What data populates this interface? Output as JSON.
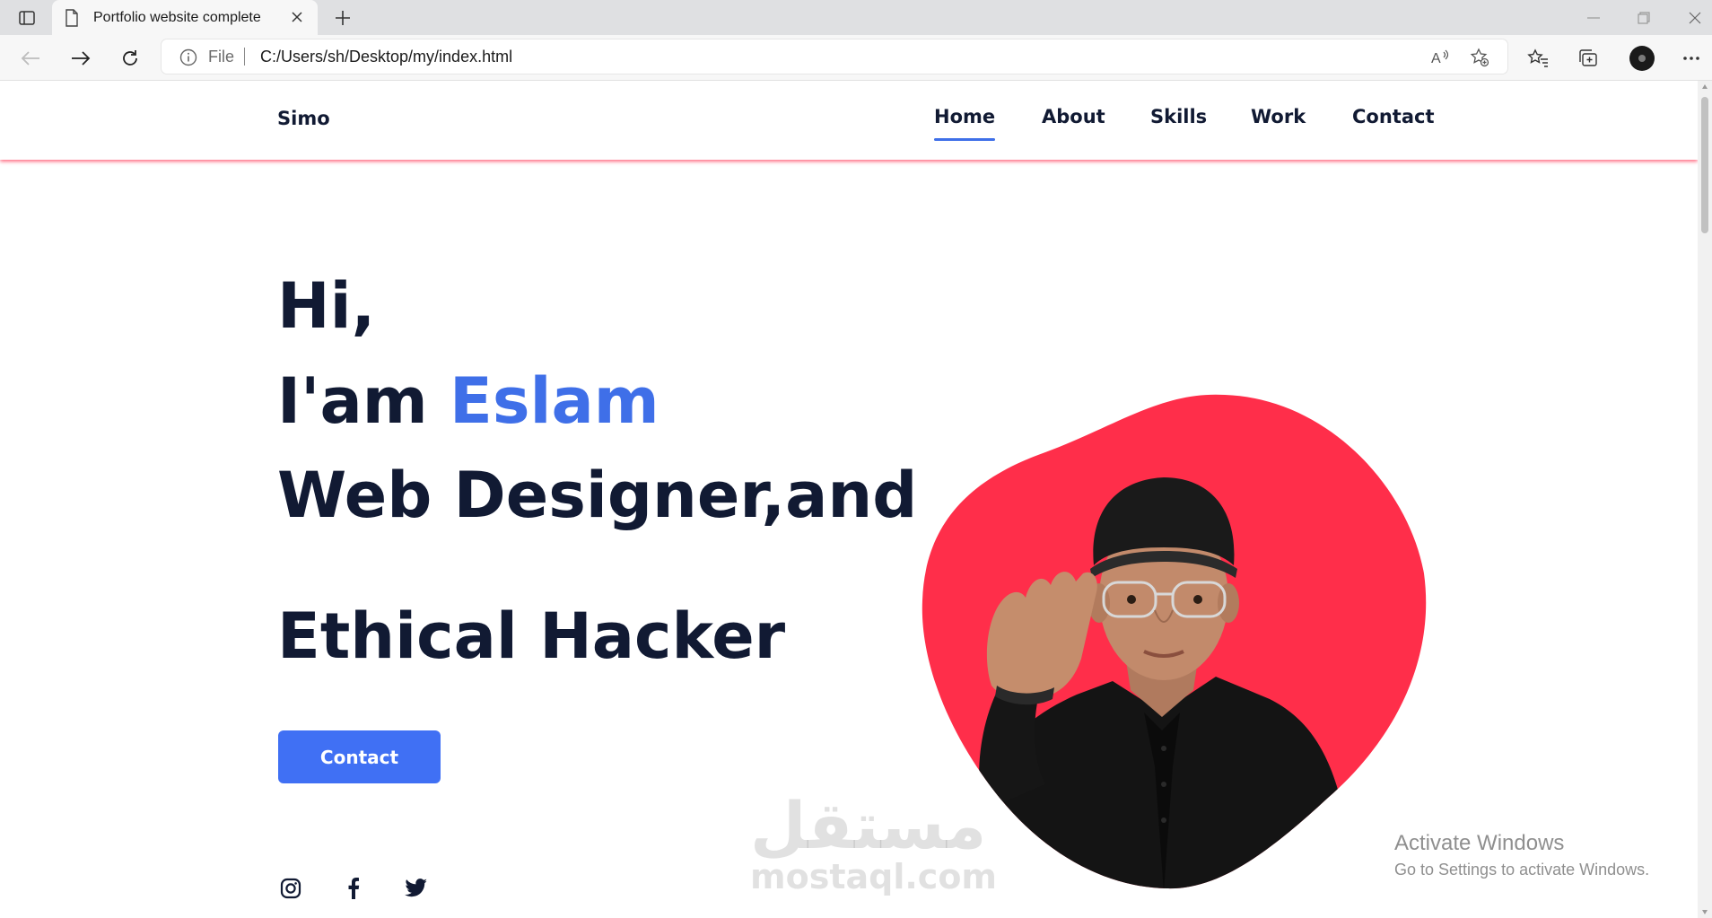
{
  "browser": {
    "tab_title": "Portfolio website complete",
    "address_scheme": "File",
    "address_url": "C:/Users/sh/Desktop/my/index.html"
  },
  "site": {
    "logo": "Simo",
    "nav": [
      "Home",
      "About",
      "Skills",
      "Work",
      "Contact"
    ],
    "active_nav": "Home",
    "hero": {
      "line1": "Hi,",
      "line2_prefix": "I'am ",
      "line2_name": "Eslam",
      "line3": "Web Designer,and",
      "line4": "Ethical Hacker"
    },
    "cta_label": "Contact",
    "social": [
      "instagram-icon",
      "facebook-icon",
      "twitter-icon"
    ]
  },
  "watermark": {
    "arabic": "مستقل",
    "latin": "mostaql.com"
  },
  "os_notice": {
    "title": "Activate Windows",
    "subtitle": "Go to Settings to activate Windows."
  },
  "colors": {
    "accent_blue": "#4070f4",
    "heading_navy": "#111a33",
    "blob_red": "#ff2e4a",
    "header_shadow": "#ff3b58"
  }
}
